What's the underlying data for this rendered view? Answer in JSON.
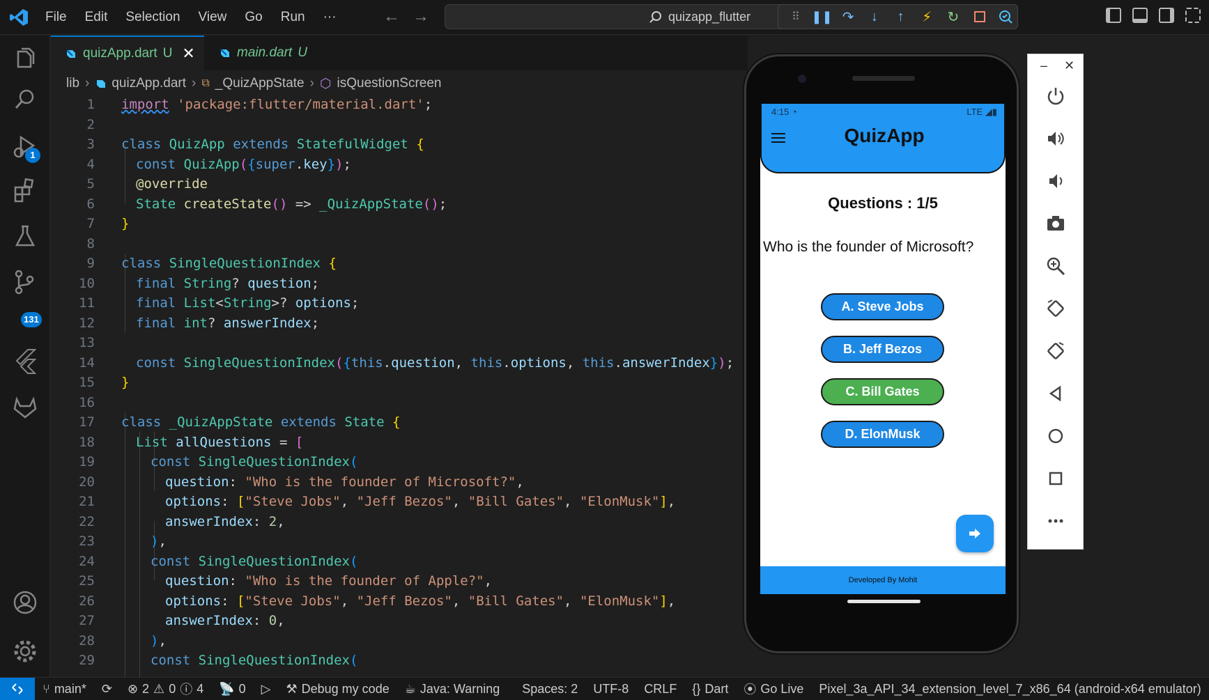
{
  "menu": [
    "File",
    "Edit",
    "Selection",
    "View",
    "Go",
    "Run",
    "···"
  ],
  "nav": {
    "back": "←",
    "forward": "→"
  },
  "search": {
    "label": "quizapp_flutter"
  },
  "tabs": [
    {
      "label": "quizApp.dart",
      "modified": "U",
      "close": "✕"
    },
    {
      "label": "main.dart",
      "modified": "U"
    }
  ],
  "breadcrumb": [
    "lib",
    "quizApp.dart",
    "_QuizAppState",
    "isQuestionScreen"
  ],
  "activity": {
    "debug_badge": "1",
    "scm_badge": "131"
  },
  "line_numbers": [
    "1",
    "2",
    "3",
    "4",
    "5",
    "6",
    "7",
    "8",
    "9",
    "10",
    "11",
    "12",
    "13",
    "14",
    "15",
    "16",
    "17",
    "18",
    "19",
    "20",
    "21",
    "22",
    "23",
    "24",
    "25",
    "26",
    "27",
    "28",
    "29"
  ],
  "code": {
    "l1": [
      "import",
      " ",
      "'package:flutter/material.dart'",
      ";"
    ],
    "l3": [
      "class",
      " ",
      "QuizApp",
      " ",
      "extends",
      " ",
      "StatefulWidget",
      " ",
      "{"
    ],
    "l4": [
      "const",
      " ",
      "QuizApp",
      "(",
      "{",
      "super",
      ".",
      "key",
      "}",
      ")",
      ";"
    ],
    "l5": [
      "@override"
    ],
    "l6": [
      "State",
      " ",
      "createState",
      "()",
      " => ",
      "_QuizAppState",
      "()",
      ";"
    ],
    "l7": [
      "}"
    ],
    "l9": [
      "class",
      " ",
      "SingleQuestionIndex",
      " ",
      "{"
    ],
    "l10": [
      "final",
      " ",
      "String",
      "? ",
      "question",
      ";"
    ],
    "l11": [
      "final",
      " ",
      "List",
      "<",
      "String",
      ">? ",
      "options",
      ";"
    ],
    "l12": [
      "final",
      " ",
      "int",
      "? ",
      "answerIndex",
      ";"
    ],
    "l14": [
      "const",
      " ",
      "SingleQuestionIndex",
      "(",
      "{",
      "this",
      ".",
      "question",
      ", ",
      "this",
      ".",
      "options",
      ", ",
      "this",
      ".",
      "answerIndex",
      "}",
      ")",
      ";"
    ],
    "l15": [
      "}"
    ],
    "l17": [
      "class",
      " ",
      "_QuizAppState",
      " ",
      "extends",
      " ",
      "State",
      " ",
      "{"
    ],
    "l18": [
      "List",
      " ",
      "allQuestions",
      " = ",
      "["
    ],
    "l19": [
      "const",
      " ",
      "SingleQuestionIndex",
      "("
    ],
    "l20": [
      "question",
      ": ",
      "\"Who is the founder of Microsoft?\"",
      ","
    ],
    "l21": [
      "options",
      ": ",
      "[",
      "\"Steve Jobs\"",
      ", ",
      "\"Jeff Bezos\"",
      ", ",
      "\"Bill Gates\"",
      ", ",
      "\"ElonMusk\"",
      "]",
      ","
    ],
    "l22": [
      "answerIndex",
      ": ",
      "2",
      ","
    ],
    "l23": [
      ")",
      ","
    ],
    "l24": [
      "const",
      " ",
      "SingleQuestionIndex",
      "("
    ],
    "l25": [
      "question",
      ": ",
      "\"Who is the founder of Apple?\"",
      ","
    ],
    "l26": [
      "options",
      ": ",
      "[",
      "\"Steve Jobs\"",
      ", ",
      "\"Jeff Bezos\"",
      ", ",
      "\"Bill Gates\"",
      ", ",
      "\"ElonMusk\"",
      "]",
      ","
    ],
    "l27": [
      "answerIndex",
      ": ",
      "0",
      ","
    ],
    "l28": [
      ")",
      ","
    ],
    "l29": [
      "const",
      " ",
      "SingleQuestionIndex",
      "("
    ]
  },
  "app": {
    "time": "4:15",
    "network": "LTE",
    "title": "QuizApp",
    "question_count": "Questions : 1/5",
    "question": "Who is the founder of Microsoft?",
    "options": [
      "A. Steve Jobs",
      "B. Jeff Bezos",
      "C. Bill Gates",
      "D. ElonMusk"
    ],
    "correct_index": 2,
    "footer": "Developed By Mohit"
  },
  "emulator": {
    "minimize": "–",
    "close": "✕"
  },
  "status": {
    "branch": "main*",
    "errors": "2",
    "warnings": "0",
    "infos": "4",
    "ports": "0",
    "debug": "Debug my code",
    "java": "Java: Warning",
    "spaces": "Spaces: 2",
    "encoding": "UTF-8",
    "eol": "CRLF",
    "language": "Dart",
    "golive": "Go Live",
    "device": "Pixel_3a_API_34_extension_level_7_x86_64 (android-x64 emulator)"
  },
  "colors": {
    "accent": "#0078d4",
    "app_primary": "#2196f3",
    "correct": "#4caf50",
    "option": "#1e88e5"
  }
}
